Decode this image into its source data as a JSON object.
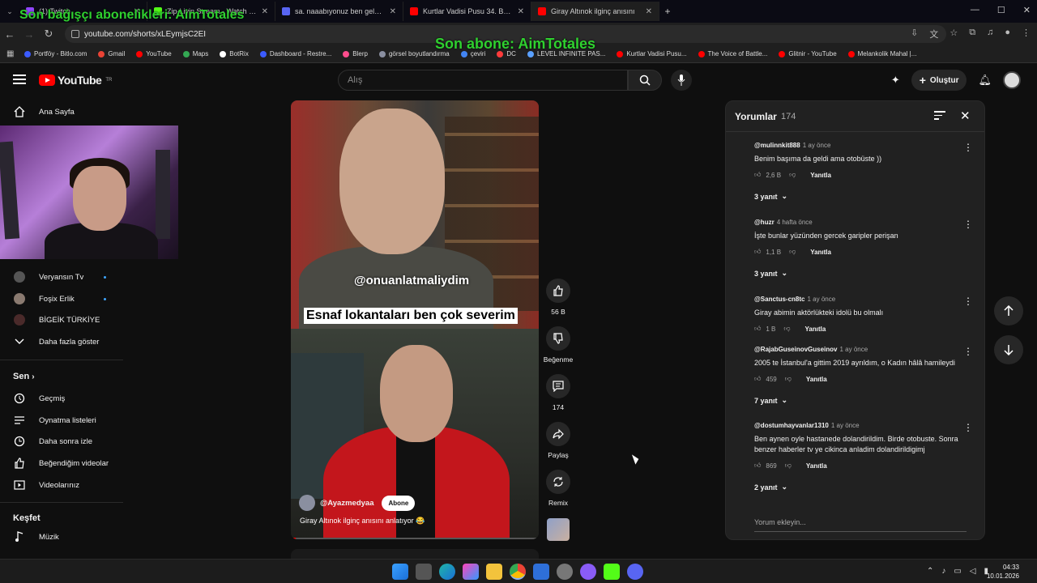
{
  "overlay": {
    "top_left": "Son bağışçı abonelikleri: AimTotales",
    "top_center": "Son abone: AimTotales"
  },
  "browser": {
    "tabs": [
      {
        "label": "(1) Twitch",
        "color": "#9146ff"
      },
      {
        "label": "Zip-Livin Stream - Watch Live o",
        "color": "#53fc18"
      },
      {
        "label": "sa. naaabıyonuz ben geldim - R",
        "color": "#5865f2"
      },
      {
        "label": "Kurtlar Vadisi Pusu 34. Bölüm Fu",
        "color": "#ff0000"
      },
      {
        "label": "Giray Altınok ilginç anısını",
        "color": "#ff0000"
      }
    ],
    "url": "youtube.com/shorts/xLEymjsC2EI",
    "bookmarks": [
      {
        "label": "Portföy - Bitlo.com",
        "color": "#3b5bff"
      },
      {
        "label": "Gmail",
        "color": "#ea4335"
      },
      {
        "label": "YouTube",
        "color": "#ff0000"
      },
      {
        "label": "Maps",
        "color": "#34a853"
      },
      {
        "label": "BotRix",
        "color": "#ffffff"
      },
      {
        "label": "Dashboard - Restre...",
        "color": "#3b5bff"
      },
      {
        "label": "Blerp",
        "color": "#ff4d8d"
      },
      {
        "label": "görsel boyutlandırma",
        "color": "#8a8fa0"
      },
      {
        "label": "çeviri",
        "color": "#4285f4"
      },
      {
        "label": "DC",
        "color": "#ff3b3b"
      },
      {
        "label": "LEVEL INFINITE PAS...",
        "color": "#5aa0ff"
      },
      {
        "label": "Kurtlar Vadisi Pusu...",
        "color": "#ff0000"
      },
      {
        "label": "The Voice of Battle...",
        "color": "#ff0000"
      },
      {
        "label": "Glitnir - YouTube",
        "color": "#ff0000"
      },
      {
        "label": "Melankolik Mahal |...",
        "color": "#ff0000"
      }
    ]
  },
  "header": {
    "logo_text": "YouTube",
    "logo_sup": "TR",
    "search_placeholder": "Alış",
    "create_label": "Oluştur"
  },
  "sidebar": {
    "home": "Ana Sayfa",
    "subscriptions": [
      {
        "label": "Veryansın Tv",
        "color": "#555555"
      },
      {
        "label": "Foşix Erlik",
        "color": "#8a7a70"
      },
      {
        "label": "BİGEİK TÜRKİYE",
        "color": "#4a2a2a"
      }
    ],
    "show_more": "Daha fazla göster",
    "you_heading": "Sen",
    "you_items": [
      "Geçmiş",
      "Oynatma listeleri",
      "Daha sonra izle",
      "Beğendiğim videolar",
      "Videolarınız"
    ],
    "explore_heading": "Keşfet",
    "music": "Müzik"
  },
  "video": {
    "watermark": "@onuanlatmaliydim",
    "caption": "Esnaf lokantaları ben çok severim",
    "channel": "@Ayazmedyaa",
    "subscribe": "Abone",
    "title": "Giray Altınok ilginç anısını anlatıyor 😂",
    "progress": 0.02
  },
  "actions": {
    "like_count": "56 B",
    "dislike_label": "Beğenme",
    "comment_count": "174",
    "share_label": "Paylaş",
    "remix_label": "Remix"
  },
  "comments": {
    "title": "Yorumlar",
    "count": "174",
    "add_placeholder": "Yorum ekleyin...",
    "items": [
      {
        "user": "@mulinnkit888",
        "time": "1 ay önce",
        "text": "Benim başıma da geldi ama otobüste ))",
        "likes": "2,6 B",
        "reply": "Yanıtla",
        "replies": "3 yanıt"
      },
      {
        "user": "@huzr",
        "time": "4 hafta önce",
        "text": "İşte bunlar yüzünden gercek garipler perişan",
        "likes": "1,1 B",
        "reply": "Yanıtla",
        "replies": "3 yanıt"
      },
      {
        "user": "@Sanctus-cn8tc",
        "time": "1 ay önce",
        "text": "Giray abimin aktörlükteki idolü bu olmalı",
        "likes": "1 B",
        "reply": "Yanıtla",
        "replies": ""
      },
      {
        "user": "@RajabGuseinovGuseinov",
        "time": "1 ay önce",
        "text": "2005 te İstanbul'a gittim 2019 ayrıldım, o Kadın hâlâ hamileydi",
        "likes": "459",
        "reply": "Yanıtla",
        "replies": "7 yanıt"
      },
      {
        "user": "@dostumhayvanlar1310",
        "time": "1 ay önce",
        "text": "Ben aynen oyle hastanede dolandirildim. Birde otobuste. Sonra benzer haberler tv ye cikinca anladim dolandirildigimj",
        "likes": "869",
        "reply": "Yanıtla",
        "replies": "2 yanıt"
      }
    ]
  },
  "taskbar": {
    "time": "04:33",
    "date": "10.01.2026"
  }
}
